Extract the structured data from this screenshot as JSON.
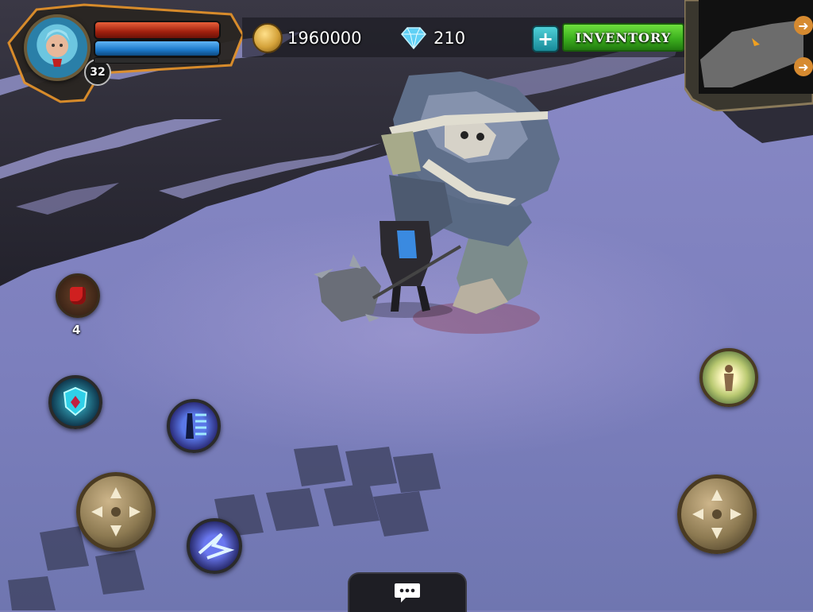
{
  "player": {
    "level": "32",
    "health_color": "#c0301c",
    "mana_color": "#1c78c8"
  },
  "currency": {
    "gold": "1960000",
    "gems": "210"
  },
  "buttons": {
    "inventory_label": "INVENTORY",
    "add_icon": "plus-icon"
  },
  "potion": {
    "count": "4",
    "icon": "red-potion-icon"
  },
  "skills": [
    "shield-skill-icon",
    "ice-wall-skill-icon",
    "lightning-skill-icon",
    "teleport-skill-icon"
  ],
  "chat": {
    "icon": "chat-bubble-icon"
  },
  "colors": {
    "inventory_green": "#3cb01e",
    "accent_gold": "#d4a23a"
  }
}
